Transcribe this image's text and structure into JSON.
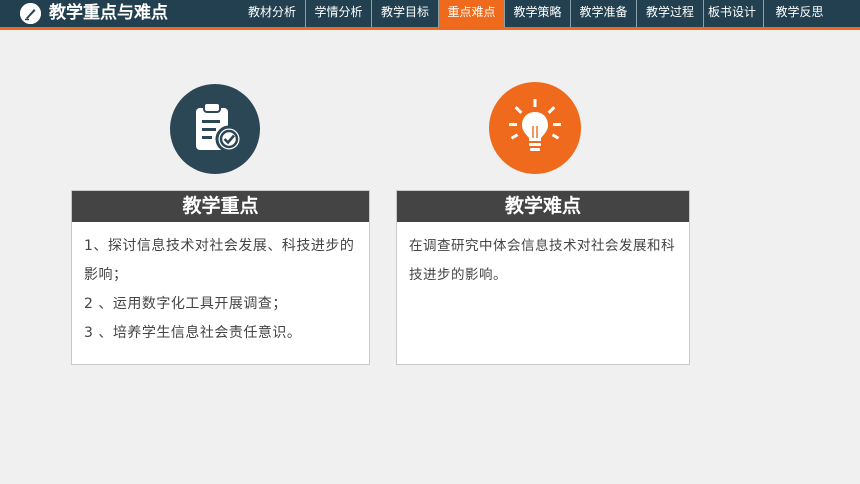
{
  "header": {
    "title": "教学重点与难点",
    "logo_icon": "pen-logo-icon",
    "nav": [
      {
        "label": "教材分析",
        "active": false
      },
      {
        "label": "学情分析",
        "active": false
      },
      {
        "label": "教学目标",
        "active": false
      },
      {
        "label": "重点难点",
        "active": true
      },
      {
        "label": "教学策略",
        "active": false
      },
      {
        "label": "教学准备",
        "active": false
      },
      {
        "label": "教学过程",
        "active": false
      },
      {
        "label": "板书设计",
        "active": false
      },
      {
        "label": "教学反思",
        "active": false
      }
    ]
  },
  "colors": {
    "header_bg": "#22404f",
    "accent": "#ef6a1c",
    "card_head_bg": "#444444",
    "icon_dark": "#2b4655",
    "icon_orange": "#ef6a1c"
  },
  "key_points": {
    "icon": "clipboard-check-icon",
    "title": "教学重点",
    "items": [
      "1、探讨信息技术对社会发展、科技进步的影响；",
      "2 、运用数字化工具开展调查；",
      "3 、培养学生信息社会责任意识。"
    ]
  },
  "difficult_points": {
    "icon": "lightbulb-icon",
    "title": "教学难点",
    "items": [
      "在调查研究中体会信息技术对社会发展和科技进步的影响。"
    ]
  }
}
